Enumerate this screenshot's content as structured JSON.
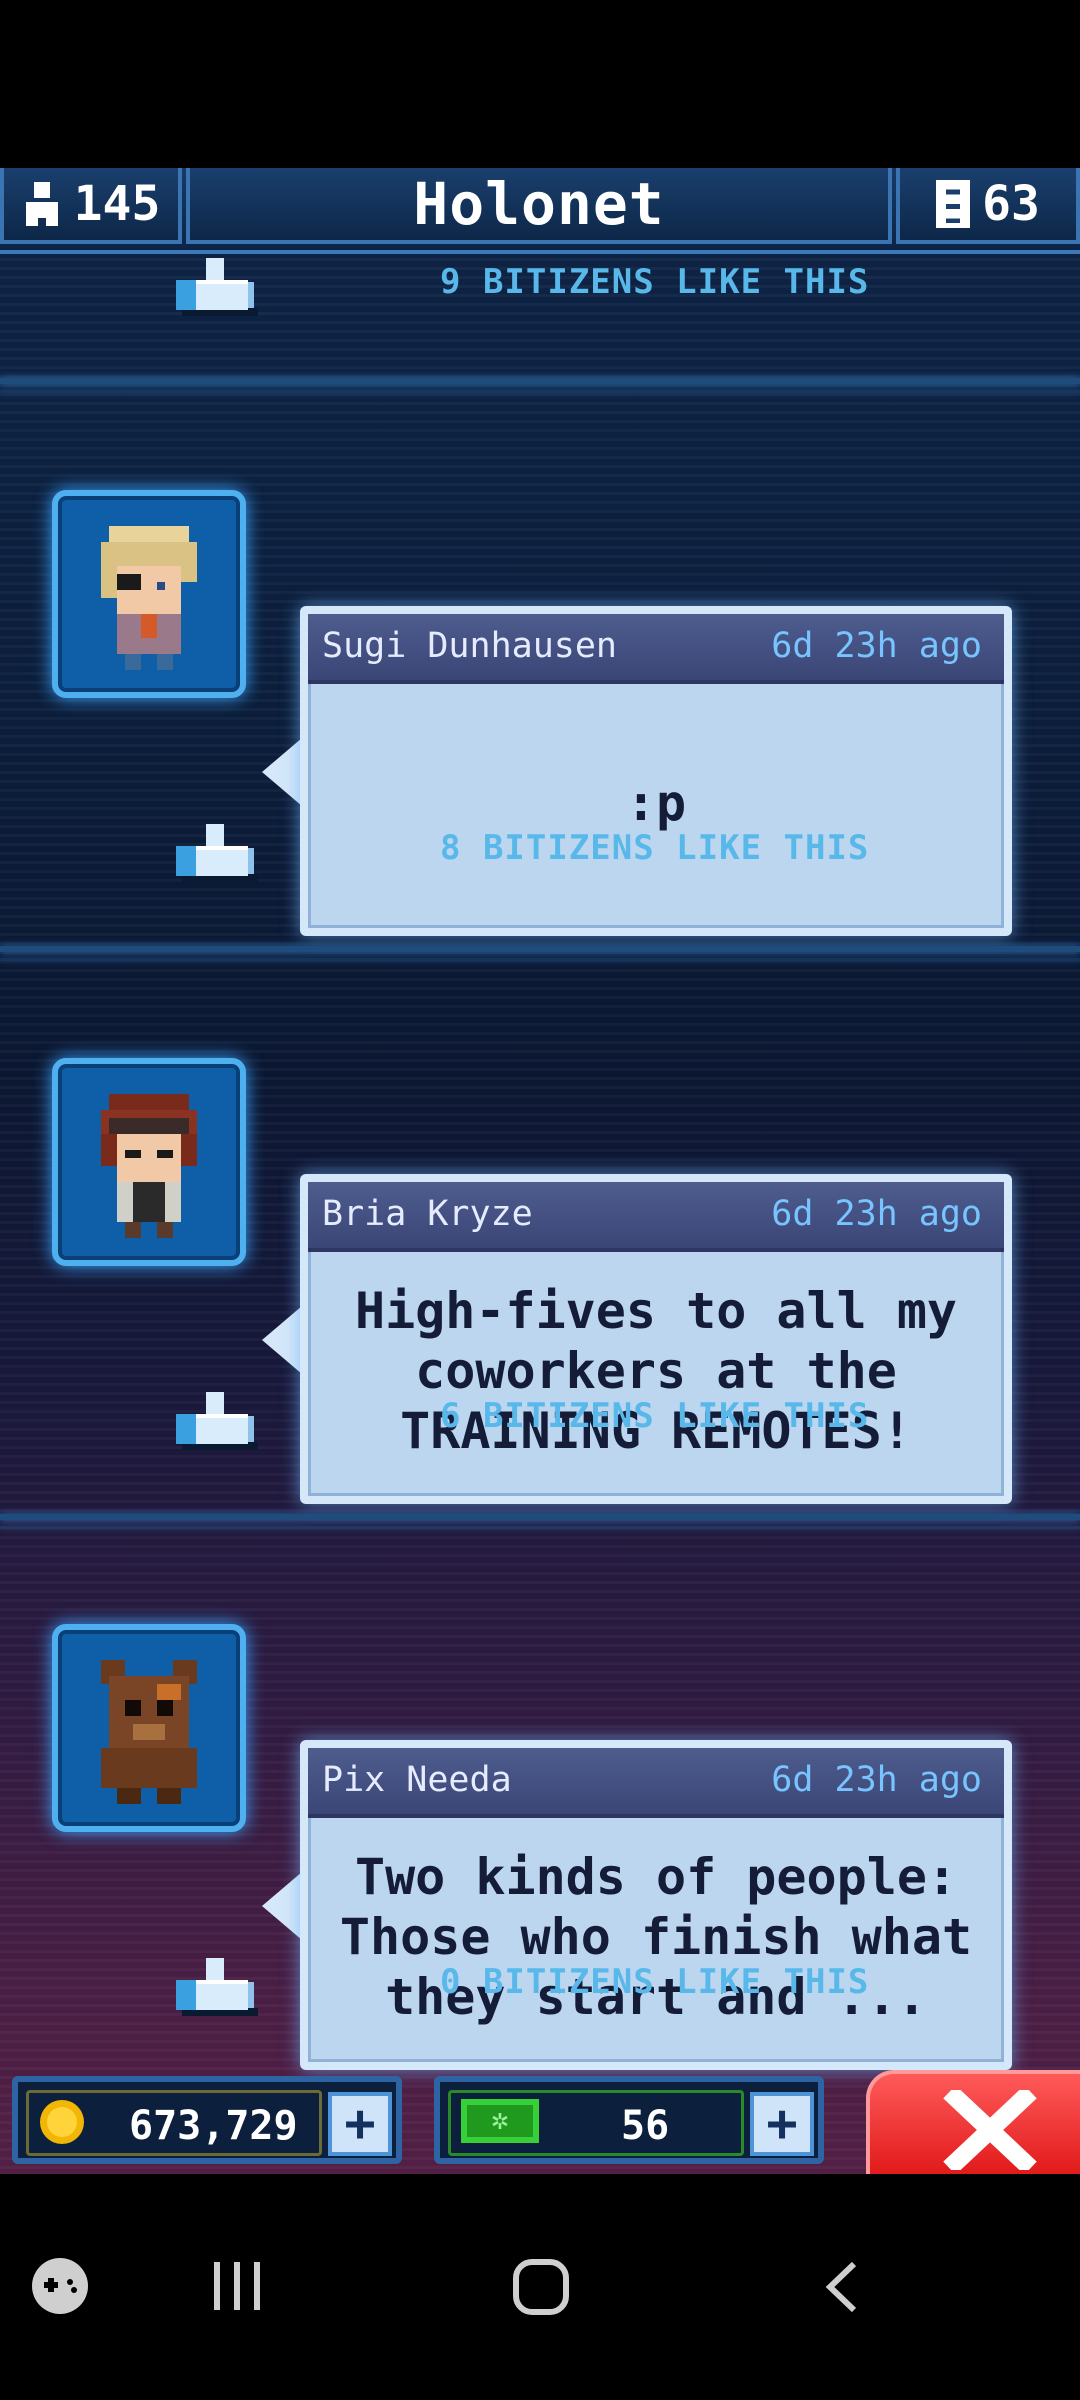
{
  "header": {
    "population": "145",
    "title": "Holonet",
    "floors": "63"
  },
  "posts": [
    {
      "likes": "9 BITIZENS LIKE THIS"
    },
    {
      "author": "Sugi Dunhausen",
      "time": "6d 23h ago",
      "message": ":p",
      "likes": "8 BITIZENS LIKE THIS"
    },
    {
      "author": "Bria Kryze",
      "time": "6d 23h ago",
      "message": "High-fives to all my coworkers at the TRAINING REMOTES!",
      "likes": "6 BITIZENS LIKE THIS"
    },
    {
      "author": "Pix Needa",
      "time": "6d 23h ago",
      "message": "Two kinds of people: Those who finish what they start and ...",
      "likes": "0 BITIZENS LIKE THIS"
    }
  ],
  "footer": {
    "coins": "673,729",
    "bux": "56"
  },
  "colors": {
    "accent": "#4fb0f0",
    "likes_text": "#59b8ea",
    "close_red": "#e01818"
  },
  "icons": [
    "person-icon",
    "elevator-icon",
    "thumbs-up-icon",
    "coin-icon",
    "bux-icon",
    "plus-icon",
    "close-icon",
    "game-launcher-icon",
    "recents-icon",
    "home-icon",
    "back-icon"
  ]
}
